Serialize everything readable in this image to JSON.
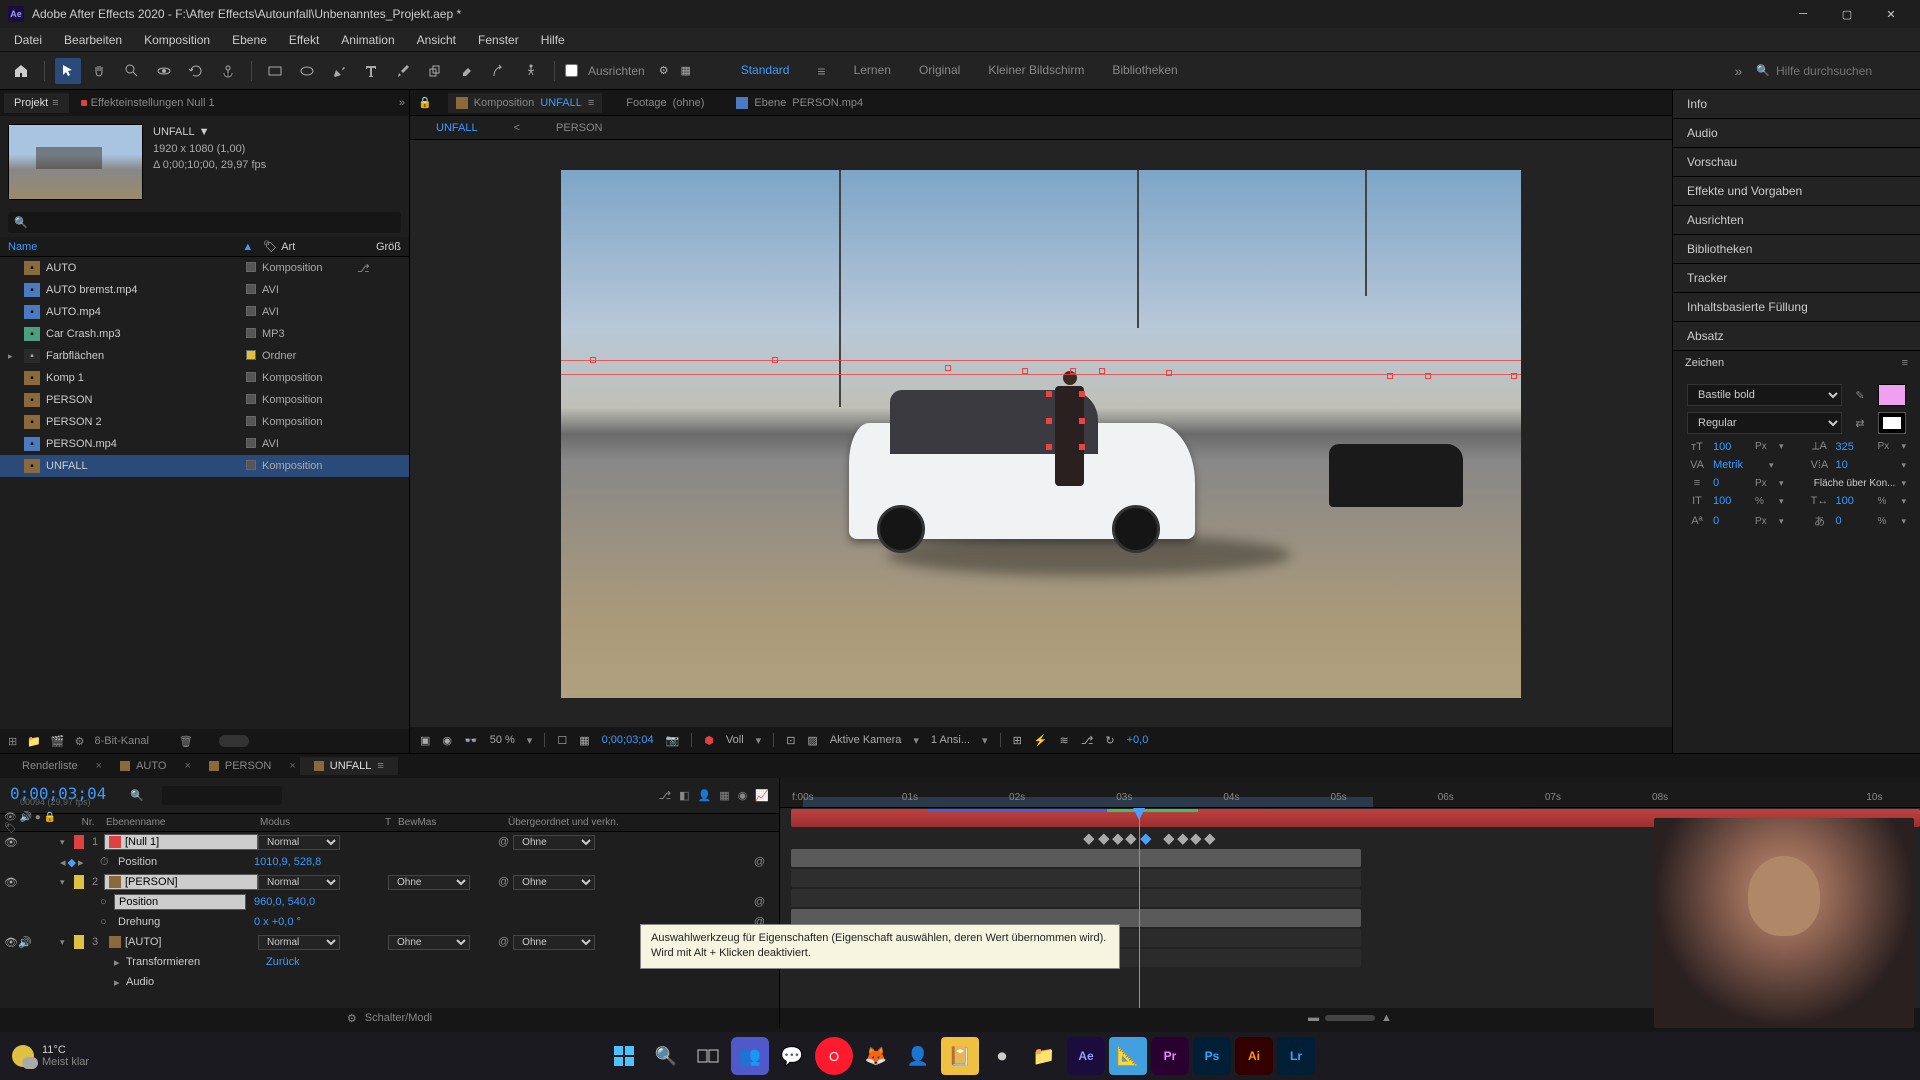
{
  "titlebar": {
    "app_icon_text": "Ae",
    "title": "Adobe After Effects 2020 - F:\\After Effects\\Autounfall\\Unbenanntes_Projekt.aep *"
  },
  "menu": [
    "Datei",
    "Bearbeiten",
    "Komposition",
    "Ebene",
    "Effekt",
    "Animation",
    "Ansicht",
    "Fenster",
    "Hilfe"
  ],
  "toolbar": {
    "snap": "Ausrichten",
    "workspaces": [
      "Standard",
      "Lernen",
      "Original",
      "Kleiner Bildschirm",
      "Bibliotheken"
    ],
    "active_ws": "Standard",
    "search_placeholder": "Hilfe durchsuchen"
  },
  "project_panel": {
    "tab_project": "Projekt",
    "tab_effects": "Effekteinstellungen Null 1",
    "comp_name": "UNFALL",
    "comp_res": "1920 x 1080 (1,00)",
    "comp_dur": "Δ 0;00;10;00, 29,97 fps",
    "columns": {
      "name": "Name",
      "type": "Art",
      "size": "Größ"
    },
    "items": [
      {
        "name": "AUTO",
        "type": "Komposition",
        "icon": "comp"
      },
      {
        "name": "AUTO bremst.mp4",
        "type": "AVI",
        "icon": "avi"
      },
      {
        "name": "AUTO.mp4",
        "type": "AVI",
        "icon": "avi"
      },
      {
        "name": "Car Crash.mp3",
        "type": "MP3",
        "icon": "mp3"
      },
      {
        "name": "Farbflächen",
        "type": "Ordner",
        "icon": "folder",
        "expandable": true
      },
      {
        "name": "Komp 1",
        "type": "Komposition",
        "icon": "comp"
      },
      {
        "name": "PERSON",
        "type": "Komposition",
        "icon": "comp"
      },
      {
        "name": "PERSON 2",
        "type": "Komposition",
        "icon": "comp"
      },
      {
        "name": "PERSON.mp4",
        "type": "AVI",
        "icon": "avi"
      },
      {
        "name": "UNFALL",
        "type": "Komposition",
        "icon": "comp",
        "selected": true
      }
    ],
    "footer_depth": "8-Bit-Kanal"
  },
  "comp_panel": {
    "tabs": [
      {
        "label": "Komposition",
        "name": "UNFALL",
        "active": true
      },
      {
        "label": "Footage",
        "name": "(ohne)"
      },
      {
        "label": "Ebene",
        "name": "PERSON.mp4"
      }
    ],
    "subtabs": [
      "UNFALL",
      "<",
      "PERSON"
    ],
    "footer": {
      "zoom": "50 %",
      "res": "Voll",
      "timecode": "0;00;03;04",
      "camera": "Aktive Kamera",
      "views": "1 Ansi...",
      "exposure": "+0,0"
    }
  },
  "right_panel": {
    "sections": [
      "Info",
      "Audio",
      "Vorschau",
      "Effekte und Vorgaben",
      "Ausrichten",
      "Bibliotheken",
      "Tracker",
      "Inhaltsbasierte Füllung",
      "Absatz"
    ],
    "character": {
      "title": "Zeichen",
      "font": "Bastile bold",
      "style": "Regular",
      "size": "100",
      "size_u": "Px",
      "leading": "325",
      "leading_u": "Px",
      "kerning": "Metrik",
      "tracking": "10",
      "stroke": "0",
      "stroke_u": "Px",
      "fill_over": "Fläche über Kon...",
      "vscale": "100",
      "vscale_u": "%",
      "hscale": "100",
      "hscale_u": "%",
      "baseline": "0",
      "baseline_u": "Px",
      "tsume": "0",
      "tsume_u": "%"
    }
  },
  "timeline": {
    "tabs": [
      {
        "name": "Renderliste"
      },
      {
        "name": "AUTO"
      },
      {
        "name": "PERSON"
      },
      {
        "name": "UNFALL",
        "active": true
      }
    ],
    "timecode": "0;00;03;04",
    "framecount": "00094 (29,97 fps)",
    "columns": {
      "idx": "Nr.",
      "name": "Ebenenname",
      "mode": "Modus",
      "trk": "T",
      "bew": "BewMas",
      "parent": "Übergeordnet und verkn."
    },
    "layers": [
      {
        "idx": "1",
        "name": "[Null 1]",
        "mode": "Normal",
        "parent": "Ohne",
        "color": "#e04040",
        "selected": true
      },
      {
        "prop": true,
        "name": "Position",
        "val": "1010,9, 528,8",
        "keyed": true,
        "selected_prop": false
      },
      {
        "idx": "2",
        "name": "[PERSON]",
        "mode": "Normal",
        "bew": "Ohne",
        "parent": "Ohne",
        "color": "#e0c040",
        "selected": true
      },
      {
        "prop": true,
        "name": "Position",
        "val": "960,0, 540,0",
        "keyed": false,
        "selected_prop": true
      },
      {
        "prop": true,
        "name": "Drehung",
        "val": "0 x +0,0 °",
        "keyed": false
      },
      {
        "idx": "3",
        "name": "[AUTO]",
        "mode": "Normal",
        "bew": "Ohne",
        "parent": "Ohne",
        "color": "#e0c040"
      },
      {
        "sub": true,
        "name": "Transformieren",
        "val": "Zurück"
      },
      {
        "sub": true,
        "name": "Audio",
        "val": ""
      }
    ],
    "footer": "Schalter/Modi",
    "ruler": [
      "f:00s",
      "01s",
      "02s",
      "03s",
      "04s",
      "05s",
      "06s",
      "07s",
      "08s",
      "10s"
    ],
    "playhead_pct": 31.5
  },
  "tooltip": "Auswahlwerkzeug für Eigenschaften (Eigenschaft auswählen, deren Wert übernommen wird). Wird mit Alt + Klicken deaktiviert.",
  "taskbar": {
    "temp": "11°C",
    "weather": "Meist klar"
  }
}
